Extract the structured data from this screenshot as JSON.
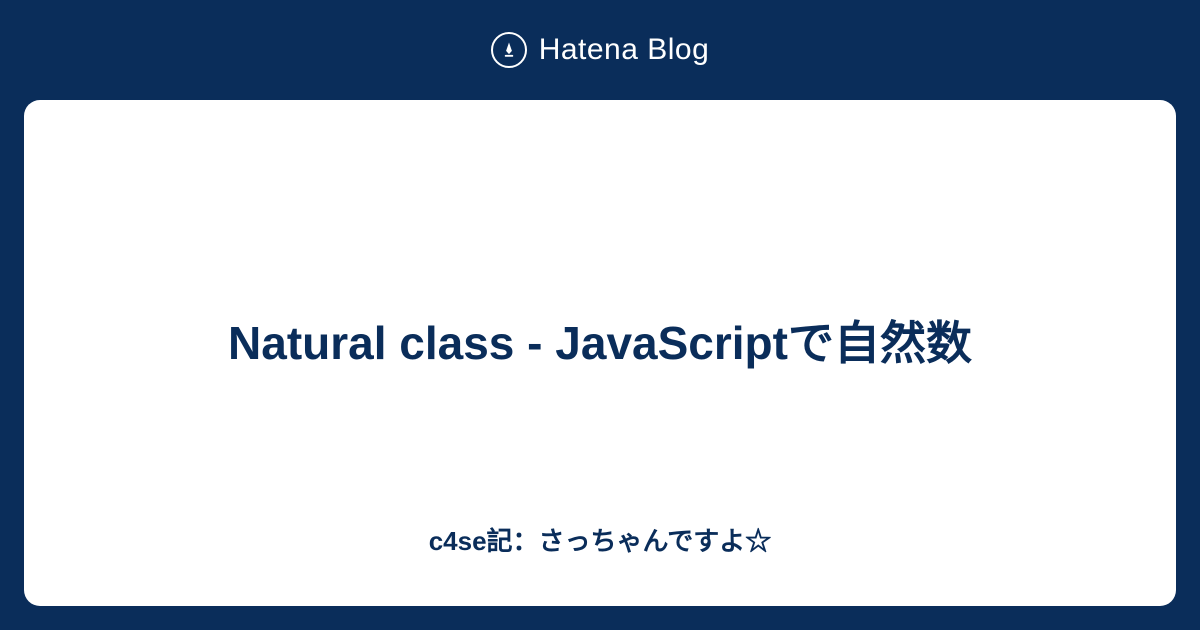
{
  "header": {
    "brand": "Hatena Blog"
  },
  "card": {
    "title": "Natural class - JavaScriptで自然数",
    "subtitle": "c4se記：さっちゃんですよ☆"
  }
}
